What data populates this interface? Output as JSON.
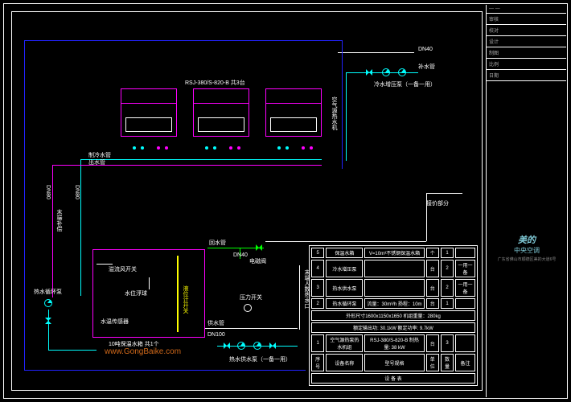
{
  "frame": {
    "title_rows": [
      "— —",
      "审核",
      "校对",
      "设计",
      "制图",
      "比例",
      "日期"
    ]
  },
  "company_logo": {
    "brand": "美的",
    "sub": "中央空调",
    "addr": "广东省佛山市顺德区美的大道6号"
  },
  "watermark": "www.GongBaike.com",
  "units": {
    "model_qty": "RSJ-380/S-820-B   共3台",
    "side_label": "空气源热水机"
  },
  "pipe_labels": {
    "dn40_top": "DN40",
    "bushui": "补水管",
    "cold_pump": "冷水增压泵（一备一用）",
    "huishui": "制冷水管",
    "chushui": "出水管",
    "dn80_l": "DN80",
    "dn80_r": "DN80",
    "mrbc": "末端补偿",
    "return_pipe": "回水管",
    "dn40_mid": "DN40",
    "solenoid": "电磁阀",
    "yewei": "液位计开关",
    "mrgshk": "末端人数热水口",
    "overflow": "溢流风开关",
    "level": "水位浮球",
    "sensor": "水温传感器",
    "tank_lbl": "10吨保温水箱   共1个",
    "hot_pump": "热水循环泵",
    "gongshui": "供水管",
    "dn100": "DN100",
    "pressure": "压力开关",
    "hot_supply": "热水供水泵（一备一用）",
    "jiejia": "接价部分"
  },
  "equipment_table": {
    "title": "设  备  表",
    "headers": [
      "序号",
      "设备名称",
      "型号规格",
      "单位",
      "数量",
      "备注"
    ],
    "rows": [
      [
        "5",
        "保温水箱",
        "V=10m³不锈钢保温水箱",
        "个",
        "1",
        ""
      ],
      [
        "4",
        "冷水增压泵",
        "",
        "台",
        "2",
        "一用一备"
      ],
      [
        "3",
        "热水供水泵",
        "",
        "台",
        "2",
        "一用一备"
      ],
      [
        "2",
        "热水循环泵",
        "流量：30m³/h 扬程：10m",
        "台",
        "1",
        ""
      ],
      [
        "",
        "",
        "外形尺寸1600x1150x1650  机组重量：280kg",
        "",
        "",
        ""
      ],
      [
        "",
        "",
        "额定输出功:  30.1kW   额定功率:  9.7kW",
        "",
        "",
        ""
      ],
      [
        "1",
        "空气源热泵热水机组",
        "RSJ-380/S-820-B   制热量: 38 kW",
        "台",
        "3",
        ""
      ]
    ]
  }
}
